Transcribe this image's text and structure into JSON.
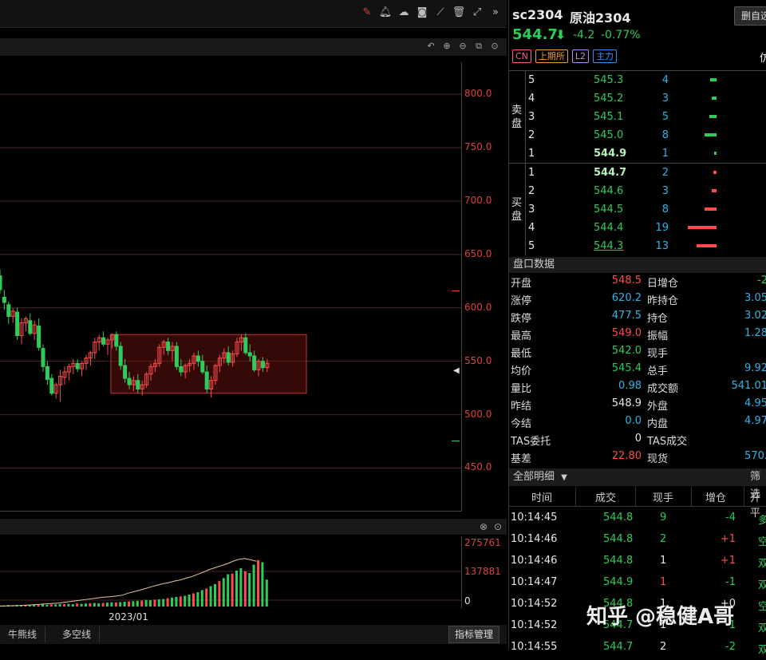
{
  "toolbar": {
    "icons": [
      "pencil-icon",
      "bell-icon",
      "cloud-icon",
      "camera-icon",
      "ruler-icon",
      "delete-icon",
      "fullscreen-icon",
      "collapse-icon"
    ]
  },
  "chart": {
    "y_axis": [
      "800.0",
      "750.0",
      "700.0",
      "650.0",
      "600.0",
      "550.0",
      "500.0",
      "450.0"
    ],
    "vol_axis": [
      "275761",
      "137881",
      "0"
    ],
    "x_label": "2023/01"
  },
  "chart_data": {
    "type": "candlestick",
    "ylim": [
      410,
      830
    ],
    "candles": [
      [
        630,
        636,
        613,
        617
      ],
      [
        610,
        617,
        598,
        605
      ],
      [
        603,
        606,
        585,
        592
      ],
      [
        592,
        600,
        586,
        597
      ],
      [
        596,
        600,
        570,
        574
      ],
      [
        574,
        590,
        566,
        586
      ],
      [
        586,
        592,
        578,
        590
      ],
      [
        588,
        595,
        574,
        576
      ],
      [
        576,
        588,
        570,
        584
      ],
      [
        583,
        590,
        560,
        563
      ],
      [
        562,
        566,
        540,
        545
      ],
      [
        545,
        550,
        528,
        533
      ],
      [
        534,
        538,
        518,
        520
      ],
      [
        520,
        530,
        515,
        528
      ],
      [
        528,
        542,
        512,
        536
      ],
      [
        535,
        545,
        528,
        540
      ],
      [
        540,
        548,
        532,
        545
      ],
      [
        545,
        552,
        538,
        548
      ],
      [
        548,
        552,
        540,
        543
      ],
      [
        543,
        550,
        536,
        548
      ],
      [
        548,
        556,
        542,
        553
      ],
      [
        553,
        560,
        546,
        558
      ],
      [
        558,
        572,
        552,
        568
      ],
      [
        568,
        575,
        560,
        572
      ],
      [
        572,
        578,
        564,
        566
      ],
      [
        566,
        572,
        556,
        570
      ],
      [
        570,
        576,
        562,
        575
      ],
      [
        575,
        578,
        560,
        564
      ],
      [
        564,
        568,
        542,
        546
      ],
      [
        546,
        552,
        530,
        534
      ],
      [
        534,
        540,
        524,
        528
      ],
      [
        528,
        536,
        522,
        532
      ],
      [
        532,
        538,
        520,
        524
      ],
      [
        524,
        532,
        518,
        528
      ],
      [
        528,
        540,
        525,
        538
      ],
      [
        538,
        548,
        532,
        545
      ],
      [
        545,
        552,
        540,
        548
      ],
      [
        548,
        566,
        545,
        563
      ],
      [
        563,
        570,
        556,
        568
      ],
      [
        568,
        572,
        556,
        560
      ],
      [
        560,
        568,
        550,
        564
      ],
      [
        564,
        568,
        542,
        545
      ],
      [
        545,
        552,
        536,
        540
      ],
      [
        540,
        548,
        534,
        546
      ],
      [
        546,
        552,
        540,
        548
      ],
      [
        548,
        558,
        542,
        555
      ],
      [
        555,
        560,
        545,
        550
      ],
      [
        550,
        556,
        538,
        540
      ],
      [
        540,
        546,
        520,
        524
      ],
      [
        524,
        536,
        516,
        532
      ],
      [
        532,
        548,
        528,
        546
      ],
      [
        546,
        556,
        540,
        553
      ],
      [
        553,
        562,
        548,
        558
      ],
      [
        558,
        564,
        546,
        549
      ],
      [
        549,
        560,
        545,
        557
      ],
      [
        557,
        572,
        554,
        568
      ],
      [
        568,
        575,
        560,
        572
      ],
      [
        572,
        576,
        556,
        558
      ],
      [
        558,
        566,
        550,
        555
      ],
      [
        555,
        560,
        540,
        542
      ],
      [
        542,
        552,
        536,
        550
      ],
      [
        550,
        554,
        540,
        544
      ],
      [
        544,
        552,
        540,
        548
      ]
    ],
    "volume": [
      4,
      4,
      5,
      4,
      5,
      5,
      6,
      5,
      6,
      6,
      7,
      6,
      7,
      7,
      8,
      8,
      9,
      8,
      10,
      9,
      10,
      11,
      12,
      11,
      12,
      13,
      14,
      14,
      15,
      16,
      17,
      18,
      19,
      20,
      22,
      21,
      23,
      24,
      25,
      28,
      30,
      32,
      34,
      36,
      40,
      44,
      48,
      55,
      60,
      68,
      75,
      85,
      95,
      108,
      110,
      120,
      128,
      118,
      112,
      140,
      155,
      148,
      90
    ],
    "oi": [
      2,
      3,
      4,
      5,
      6,
      8,
      10,
      12,
      14,
      16,
      18,
      22,
      26,
      30,
      34,
      38,
      42,
      46,
      50,
      52,
      55,
      60,
      70,
      78,
      86,
      95,
      104,
      112,
      120,
      126,
      134,
      140,
      150,
      158,
      170,
      182,
      195,
      205,
      215,
      225,
      238,
      248,
      252,
      246,
      238
    ]
  },
  "subpanel": {
    "icons": [
      "close-icon",
      "settings-icon"
    ]
  },
  "bottom_tabs": [
    "牛熊线",
    "多空线"
  ],
  "indicator_btn": "指标管理",
  "quote": {
    "symbol": "sc2304",
    "name": "原油2304",
    "price": "544.7",
    "change": "-4.2",
    "pct": "-0.77%",
    "add_btn": "删自选",
    "badges": [
      "CN",
      "上期所",
      "L2",
      "主力"
    ],
    "edge_char": "仿"
  },
  "orderbook": {
    "sell_label": [
      "卖",
      "盘"
    ],
    "buy_label": [
      "买",
      "盘"
    ],
    "asks": [
      {
        "level": "5",
        "price": "545.3",
        "vol": "4",
        "bar": 4
      },
      {
        "level": "4",
        "price": "545.2",
        "vol": "3",
        "bar": 3
      },
      {
        "level": "3",
        "price": "545.1",
        "vol": "5",
        "bar": 5
      },
      {
        "level": "2",
        "price": "545.0",
        "vol": "8",
        "bar": 8
      },
      {
        "level": "1",
        "price": "544.9",
        "vol": "1",
        "bar": 1
      }
    ],
    "bids": [
      {
        "level": "1",
        "price": "544.7",
        "vol": "2",
        "bar": 2
      },
      {
        "level": "2",
        "price": "544.6",
        "vol": "3",
        "bar": 3
      },
      {
        "level": "3",
        "price": "544.5",
        "vol": "8",
        "bar": 8
      },
      {
        "level": "4",
        "price": "544.4",
        "vol": "19",
        "bar": 19
      },
      {
        "level": "5",
        "price": "544.3",
        "vol": "13",
        "bar": 13
      }
    ]
  },
  "stats_title": "盘口数据",
  "stats": [
    {
      "l": "开盘",
      "v": "548.5",
      "vc": "#ff4b4b",
      "l2": "日增仓",
      "v2": "-2",
      "v2c": "#2ecc5a"
    },
    {
      "l": "涨停",
      "v": "620.2",
      "vc": "#2fb4e6",
      "l2": "昨持仓",
      "v2": "3.05",
      "v2c": "#2fb4e6"
    },
    {
      "l": "跌停",
      "v": "477.5",
      "vc": "#2fb4e6",
      "l2": "持仓",
      "v2": "3.02",
      "v2c": "#2fb4e6"
    },
    {
      "l": "最高",
      "v": "549.0",
      "vc": "#ff4b4b",
      "l2": "振幅",
      "v2": "1.28",
      "v2c": "#2fb4e6"
    },
    {
      "l": "最低",
      "v": "542.0",
      "vc": "#2ecc5a",
      "l2": "现手",
      "v2": "",
      "v2c": "#2fb4e6"
    },
    {
      "l": "均价",
      "v": "545.4",
      "vc": "#2ecc5a",
      "l2": "总手",
      "v2": "9.92",
      "v2c": "#2fb4e6"
    },
    {
      "l": "量比",
      "v": "0.98",
      "vc": "#2fb4e6",
      "l2": "成交额",
      "v2": "541.01",
      "v2c": "#2fb4e6"
    },
    {
      "l": "昨结",
      "v": "548.9",
      "vc": "#e8e8e8",
      "l2": "外盘",
      "v2": "4.95",
      "v2c": "#2fb4e6"
    },
    {
      "l": "今结",
      "v": "0.0",
      "vc": "#2fb4e6",
      "l2": "内盘",
      "v2": "4.97",
      "v2c": "#2fb4e6"
    },
    {
      "l": "TAS委托",
      "v": "0",
      "vc": "#e8e8e8",
      "l2": "TAS成交",
      "v2": "",
      "v2c": "#2fb4e6"
    },
    {
      "l": "基差",
      "v": "22.80",
      "vc": "#ff4b4b",
      "l2": "现货",
      "v2": "570.",
      "v2c": "#2fb4e6"
    }
  ],
  "trades_title": "全部明细",
  "trades_filter": "筛选",
  "trades_headers": [
    "时间",
    "成交",
    "现手",
    "增仓",
    "开平"
  ],
  "trades": [
    {
      "t": "10:14:45",
      "p": "544.8",
      "pc": "#2ecc5a",
      "h": "9",
      "hc": "#2ecc5a",
      "i": "-4",
      "ic": "#2ecc5a",
      "k": "多",
      "kc": "#2ecc5a"
    },
    {
      "t": "10:14:46",
      "p": "544.8",
      "pc": "#2ecc5a",
      "h": "2",
      "hc": "#2ecc5a",
      "i": "+1",
      "ic": "#ff4b4b",
      "k": "空",
      "kc": "#2ecc5a"
    },
    {
      "t": "10:14:46",
      "p": "544.8",
      "pc": "#2ecc5a",
      "h": "1",
      "hc": "#e8e8e8",
      "i": "+1",
      "ic": "#ff4b4b",
      "k": "双",
      "kc": "#2ecc5a"
    },
    {
      "t": "10:14:47",
      "p": "544.9",
      "pc": "#2ecc5a",
      "h": "1",
      "hc": "#ff4b4b",
      "i": "-1",
      "ic": "#2ecc5a",
      "k": "双",
      "kc": "#2ecc5a"
    },
    {
      "t": "10:14:52",
      "p": "544.8",
      "pc": "#2ecc5a",
      "h": "1",
      "hc": "#e8e8e8",
      "i": "+0",
      "ic": "#e8e8e8",
      "k": "空",
      "kc": "#2ecc5a"
    },
    {
      "t": "10:14:52",
      "p": "544.7",
      "pc": "#2ecc5a",
      "h": "1",
      "hc": "#e8e8e8",
      "i": "-1",
      "ic": "#2ecc5a",
      "k": "双",
      "kc": "#2ecc5a"
    },
    {
      "t": "10:14:55",
      "p": "544.7",
      "pc": "#2ecc5a",
      "h": "2",
      "hc": "#e8e8e8",
      "i": "-2",
      "ic": "#2ecc5a",
      "k": "双",
      "kc": "#2ecc5a"
    }
  ],
  "watermark": "知乎 @稳健A哥"
}
